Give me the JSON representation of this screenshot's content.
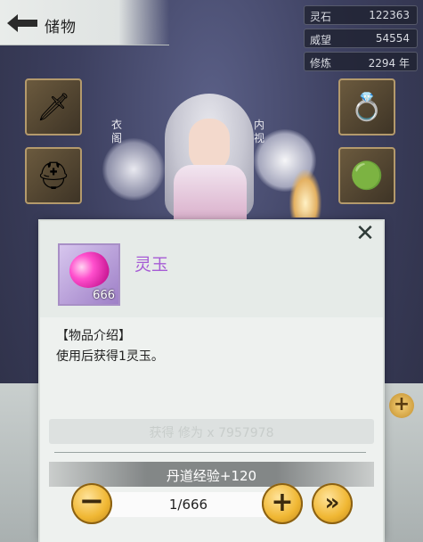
{
  "header": {
    "title": "储物"
  },
  "stats": [
    {
      "label": "灵石",
      "value": "122363"
    },
    {
      "label": "威望",
      "value": "54554"
    },
    {
      "label": "修炼",
      "value": "2294 年"
    }
  ],
  "character": {
    "left_label": "衣阁",
    "right_label": "内视"
  },
  "dialog": {
    "item_name": "灵玉",
    "item_count": "666",
    "intro_heading": "【物品介绍】",
    "intro_body": "使用后获得1灵玉。",
    "total_gain": "获得 修为 x 7957978",
    "exp_label": "丹道经验+120",
    "quantity": "1/666",
    "close_symbol": "✕",
    "minus_symbol": "−",
    "plus_symbol": "+",
    "max_symbol": "»"
  },
  "colors": {
    "item_name": "#a65bd5",
    "gold": "#f0b733",
    "stat_bg": "#1e202d"
  }
}
